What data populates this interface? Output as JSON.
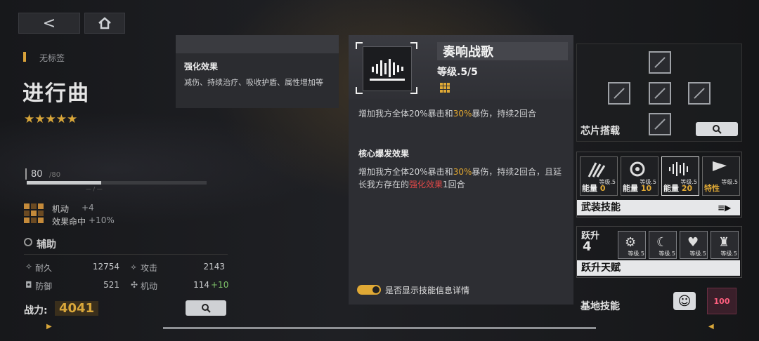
{
  "nav": {
    "back": "<",
    "home": "⌂"
  },
  "unit": {
    "tag": "无标签",
    "name": "进行曲",
    "stars": "★★★★★",
    "hp_current": "80",
    "hp_max": "/80",
    "hp_sub": "— / —",
    "mobility_label": "机动",
    "mobility_bonus": "+4",
    "hit_label": "效果命中",
    "hit_bonus": "+10%",
    "role": "辅助",
    "stats": [
      {
        "label": "耐久",
        "value": "12754"
      },
      {
        "label": "攻击",
        "value": "2143"
      },
      {
        "label": "防御",
        "value": "521"
      },
      {
        "label": "机动",
        "value": "114",
        "bonus": "+10"
      }
    ],
    "power_label": "战力:",
    "power_value": "4041"
  },
  "tooltip": {
    "title": "强化效果",
    "body": "减伤、持续治疗、吸收护盾、属性增加等"
  },
  "skill": {
    "name": "奏响战歌",
    "level": "等级.5/5",
    "desc_parts": [
      "增加我方全体20%暴击和",
      "30%",
      "暴伤，持续2回合"
    ],
    "core_title": "核心爆发效果",
    "core_parts": [
      "增加我方全体20%暴击和",
      "30%",
      "暴伤，持续2回合，且延长我方存在的",
      "强化效果",
      "1回合"
    ],
    "toggle_label": "是否显示技能信息详情",
    "toggle_on": true
  },
  "right": {
    "chip_label": "芯片搭载",
    "arms_label": "武装技能",
    "arms": [
      {
        "level": "等级.5",
        "energy_label": "能量",
        "energy": "0"
      },
      {
        "level": "等级.5",
        "energy_label": "能量",
        "energy": "10"
      },
      {
        "level": "等级.5",
        "energy_label": "能量",
        "energy": "20"
      },
      {
        "level": "等级.5",
        "energy_label": "特性",
        "energy": ""
      }
    ],
    "promo_label": "跃升",
    "promo_level": "4",
    "promo_talent": "跃升天赋",
    "promo_slots": [
      {
        "level": "等级.5"
      },
      {
        "level": "等级.5"
      },
      {
        "level": "等级.5"
      },
      {
        "level": "等级.5"
      }
    ],
    "base_label": "基地技能",
    "heart_value": "100"
  },
  "colors": {
    "accent": "#e0a935",
    "highlight_red": "#e04848",
    "panel": "#2d2e33"
  }
}
